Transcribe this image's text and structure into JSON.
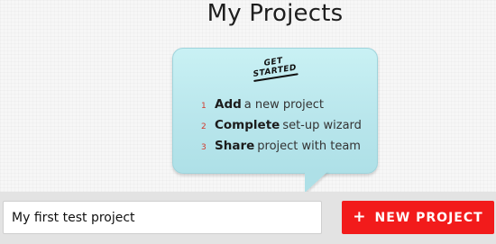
{
  "page": {
    "title": "My Projects"
  },
  "bubble": {
    "heading_line1": "GET",
    "heading_line2": "STARTED",
    "steps": [
      {
        "num": "1",
        "bold": "Add",
        "rest": "a new project"
      },
      {
        "num": "2",
        "bold": "Complete",
        "rest": "set-up wizard"
      },
      {
        "num": "3",
        "bold": "Share",
        "rest": "project with team"
      }
    ]
  },
  "form": {
    "input_value": "My first test project",
    "button_icon": "+",
    "button_label": "NEW PROJECT"
  },
  "colors": {
    "accent": "#f21b1b",
    "bubble": "#b9e6ec",
    "step_number": "#d23a2e"
  },
  "icons": {
    "button_icon": "plus-icon"
  }
}
